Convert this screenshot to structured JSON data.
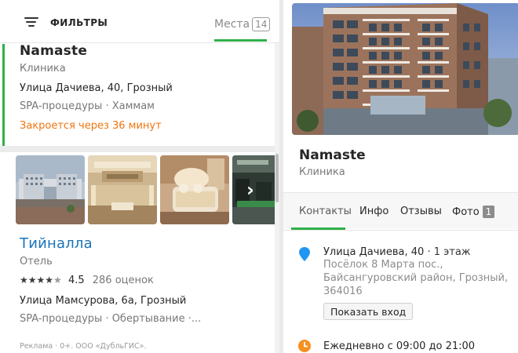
{
  "filter_bar": {
    "filters_label": "ФИЛЬТРЫ",
    "places_label": "Места",
    "places_count": "14"
  },
  "results": [
    {
      "title": "Namaste",
      "category": "Клиника",
      "address": "Улица Дачиева, 40, Грозный",
      "services": "SPA-процедуры · Хаммам",
      "status": "Закроется через 36 минут",
      "status_color": "#f0750f"
    },
    {
      "title": "Тийналла",
      "category": "Отель",
      "rating": "4.5",
      "rating_stars": 4.5,
      "reviews": "286 оценок",
      "address": "Улица Мамсурова, 6а, Грозный",
      "services": "SPA-процедуры · Обертывание ·...",
      "ad_text": "Реклама · 0+. ООО «ДубльГИС».",
      "photos": [
        "hotel-building",
        "lobby",
        "bedroom",
        "gym"
      ]
    }
  ],
  "detail": {
    "title": "Namaste",
    "category": "Клиника",
    "tabs": {
      "contacts": "Контакты",
      "info": "Инфо",
      "reviews": "Отзывы",
      "photo": "Фото",
      "photo_count": "1"
    },
    "address": {
      "street": "Улица Дачиева, 40",
      "floor": "· 1 этаж",
      "line2": "Посёлок 8 Марта пос.,",
      "line3": "Байсангуровский район, Грозный,",
      "postcode": "364016"
    },
    "show_entry_button": "Показать вход",
    "hours": "Ежедневно с 09:00 до 21:00"
  },
  "colors": {
    "accent_green": "#2fb04a",
    "link_blue": "#1a73b8",
    "pin_blue": "#1f96f2",
    "clock_orange": "#f5901e"
  },
  "icons": [
    "filter-icon",
    "chevron-right-icon",
    "map-pin-icon",
    "clock-icon",
    "star-icon"
  ]
}
